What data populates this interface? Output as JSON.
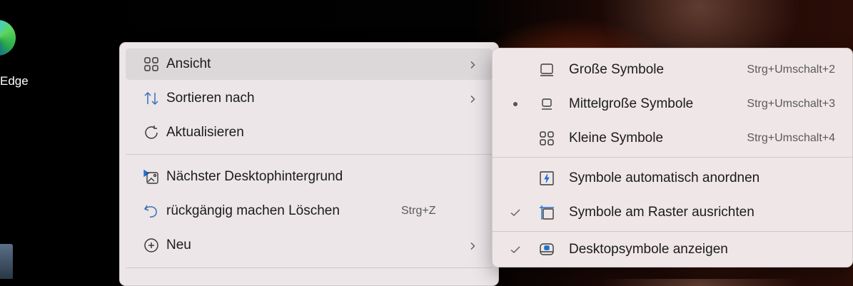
{
  "desktop": {
    "edge_label": "Edge"
  },
  "menu": {
    "items": [
      {
        "label": "Ansicht",
        "icon": "grid-icon",
        "has_submenu": true
      },
      {
        "label": "Sortieren nach",
        "icon": "sort-icon",
        "has_submenu": true
      },
      {
        "label": "Aktualisieren",
        "icon": "refresh-icon"
      },
      {
        "label": "Nächster Desktophintergrund",
        "icon": "next-wallpaper-icon"
      },
      {
        "label": "rückgängig machen Löschen",
        "icon": "undo-icon",
        "shortcut": "Strg+Z"
      },
      {
        "label": "Neu",
        "icon": "plus-circle-icon",
        "has_submenu": true
      }
    ]
  },
  "submenu": {
    "items": [
      {
        "label": "Große Symbole",
        "icon": "large-icons-icon",
        "shortcut": "Strg+Umschalt+2"
      },
      {
        "label": "Mittelgroße Symbole",
        "icon": "medium-icons-icon",
        "shortcut": "Strg+Umschalt+3",
        "selected": true
      },
      {
        "label": "Kleine Symbole",
        "icon": "small-icons-icon",
        "shortcut": "Strg+Umschalt+4"
      },
      {
        "label": "Symbole automatisch anordnen",
        "icon": "auto-arrange-icon"
      },
      {
        "label": "Symbole am Raster ausrichten",
        "icon": "align-grid-icon",
        "checked": true
      },
      {
        "label": "Desktopsymbole anzeigen",
        "icon": "show-desktop-icons-icon",
        "checked": true
      }
    ]
  }
}
